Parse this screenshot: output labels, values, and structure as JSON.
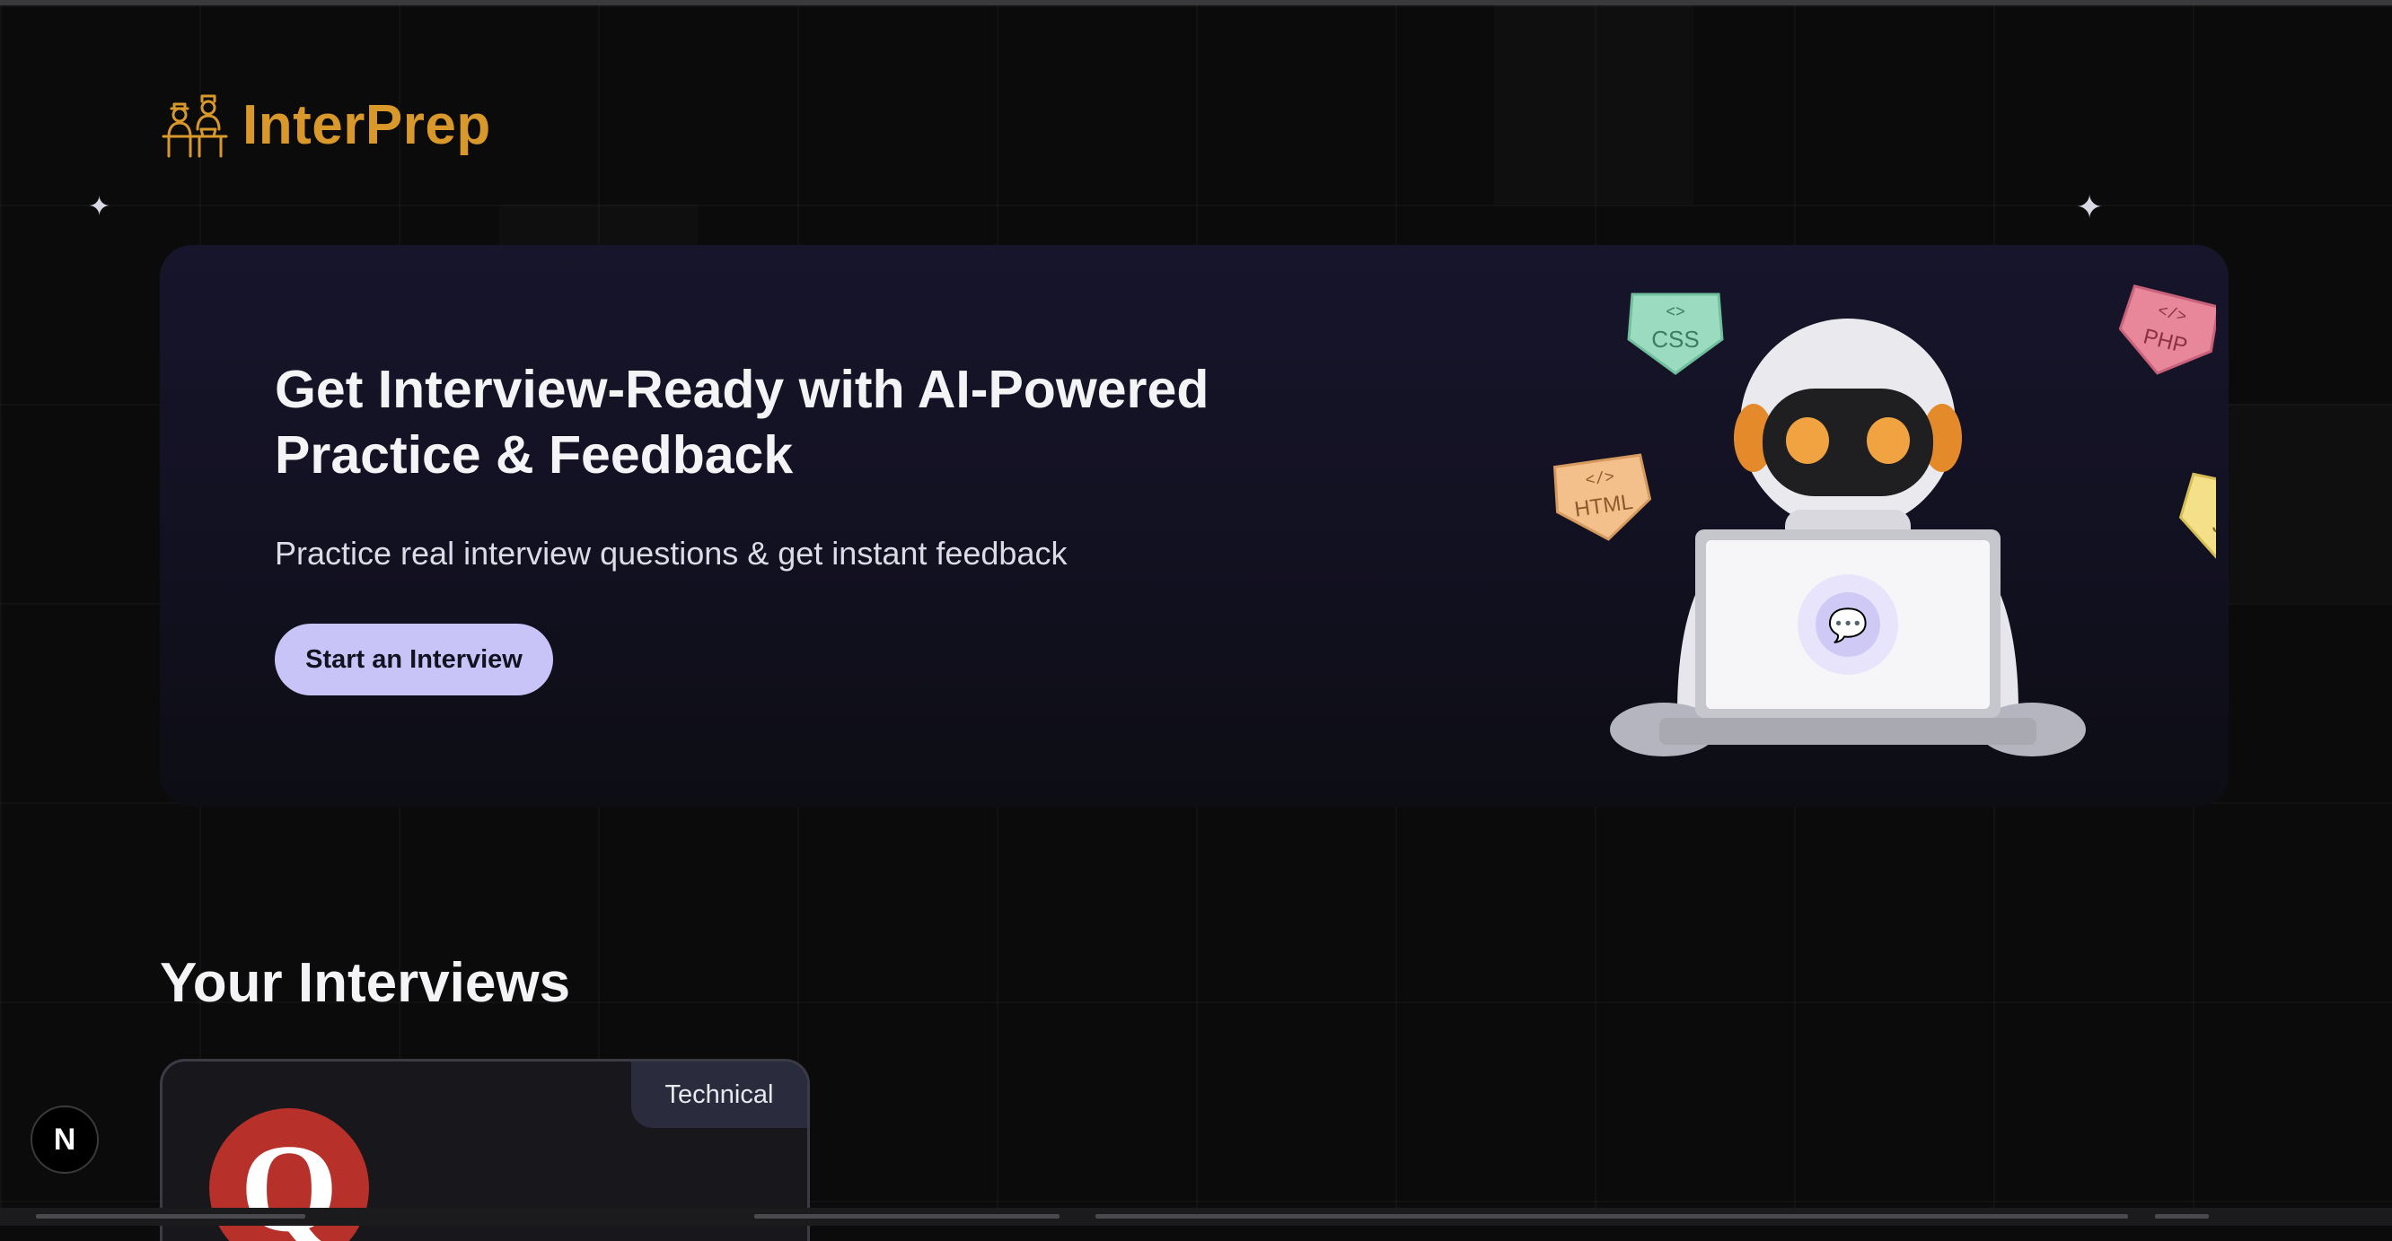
{
  "brand": {
    "name": "InterPrep",
    "icon": "interviewers-icon",
    "color": "#d9982a"
  },
  "hero": {
    "title": "Get Interview-Ready with AI-Powered Practice & Feedback",
    "subtitle": "Practice real interview questions & get instant feedback",
    "cta_label": "Start an Interview",
    "badges": [
      "CSS",
      "PHP",
      "HTML",
      "JS"
    ],
    "illustration": "robot-with-laptop"
  },
  "interviews": {
    "section_title": "Your Interviews",
    "cards": [
      {
        "type_badge": "Technical",
        "logo_letter": "Q",
        "logo_color": "#b8302a"
      }
    ]
  },
  "dev_indicator": {
    "label": "N",
    "icon": "nextjs-icon"
  },
  "colors": {
    "background": "#0b0b0c",
    "accent": "#c9c4f7",
    "hero_bg": "#17152b"
  }
}
